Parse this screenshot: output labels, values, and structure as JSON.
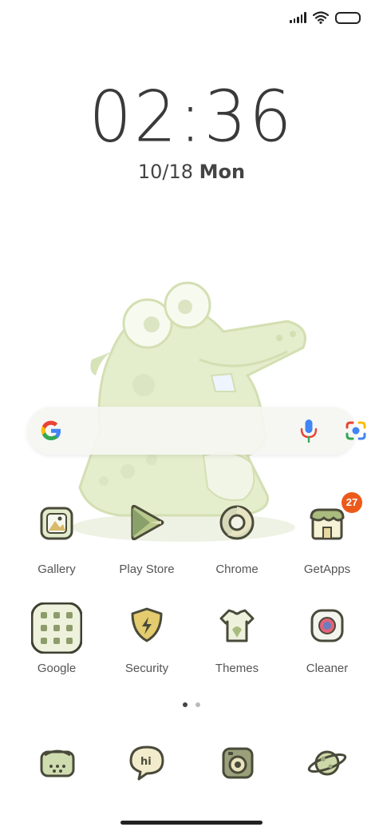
{
  "status_bar": {
    "signal_icon": "signal-icon",
    "wifi_icon": "wifi-icon",
    "battery_icon": "battery-icon"
  },
  "clock": {
    "time": "02:36",
    "date": "10/18",
    "day": "Mon"
  },
  "search": {
    "logo": "google-g-icon",
    "mic": "microphone-icon",
    "lens": "google-lens-icon"
  },
  "apps": [
    {
      "label": "Gallery",
      "icon": "gallery-icon"
    },
    {
      "label": "Play Store",
      "icon": "play-store-icon"
    },
    {
      "label": "Chrome",
      "icon": "chrome-icon"
    },
    {
      "label": "GetApps",
      "icon": "getapps-icon",
      "badge": "27"
    },
    {
      "label": "Google",
      "icon": "google-folder-icon"
    },
    {
      "label": "Security",
      "icon": "security-icon"
    },
    {
      "label": "Themes",
      "icon": "themes-icon"
    },
    {
      "label": "Cleaner",
      "icon": "cleaner-icon"
    }
  ],
  "page_indicator": {
    "pages": 2,
    "current": 1
  },
  "dock": [
    {
      "icon": "phone-icon"
    },
    {
      "icon": "messaging-icon"
    },
    {
      "icon": "camera-icon"
    },
    {
      "icon": "browser-planet-icon"
    }
  ],
  "colors": {
    "badge": "#ec5a1a",
    "icon_green": "#dfe8c6",
    "icon_outline": "#4a4a3a"
  }
}
